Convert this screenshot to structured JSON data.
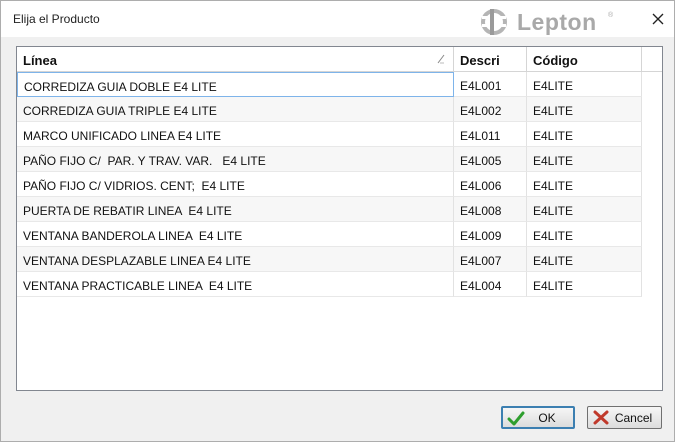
{
  "window": {
    "title": "Elija el Producto",
    "logo_text": "Lepton",
    "logo_tm": "®"
  },
  "grid": {
    "columns": [
      {
        "label": "Línea"
      },
      {
        "label": "Descri"
      },
      {
        "label": "Código"
      }
    ],
    "rows": [
      {
        "linea": "CORREDIZA GUIA DOBLE E4 LITE",
        "descri": "E4L001",
        "codigo": "E4LITE"
      },
      {
        "linea": "CORREDIZA GUIA TRIPLE E4 LITE",
        "descri": "E4L002",
        "codigo": "E4LITE"
      },
      {
        "linea": "MARCO UNIFICADO LINEA E4 LITE",
        "descri": "E4L011",
        "codigo": "E4LITE"
      },
      {
        "linea": "PAÑO FIJO C/  PAR. Y TRAV. VAR.   E4 LITE",
        "descri": "E4L005",
        "codigo": "E4LITE"
      },
      {
        "linea": "PAÑO FIJO C/ VIDRIOS. CENT;  E4 LITE",
        "descri": "E4L006",
        "codigo": "E4LITE"
      },
      {
        "linea": "PUERTA DE REBATIR LINEA  E4 LITE",
        "descri": "E4L008",
        "codigo": "E4LITE"
      },
      {
        "linea": "VENTANA BANDEROLA LINEA  E4 LITE",
        "descri": "E4L009",
        "codigo": "E4LITE"
      },
      {
        "linea": "VENTANA DESPLAZABLE LINEA E4 LITE",
        "descri": "E4L007",
        "codigo": "E4LITE"
      },
      {
        "linea": "VENTANA PRACTICABLE LINEA  E4 LITE",
        "descri": "E4L004",
        "codigo": "E4LITE"
      }
    ],
    "selected_row": 0
  },
  "buttons": {
    "ok_label": "OK",
    "cancel_label": "Cancel"
  },
  "icons": {
    "close": "close-icon",
    "ok": "checkmark-icon",
    "cancel": "cross-icon",
    "sort": "sort-indicator-icon"
  },
  "colors": {
    "selection_border": "#7eb4ea",
    "ok_check": "#2e9e2e",
    "cancel_cross": "#c0392b",
    "default_button_border": "#3c7fb1"
  }
}
